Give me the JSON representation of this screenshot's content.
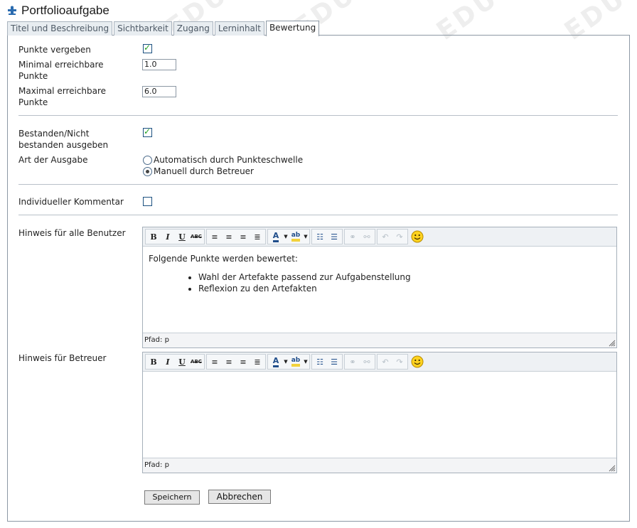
{
  "header": {
    "title": "Portfolioaufgabe",
    "icon": "puzzle-icon"
  },
  "watermark": "EDU",
  "tabs": [
    {
      "label": "Titel und Beschreibung",
      "active": false
    },
    {
      "label": "Sichtbarkeit",
      "active": false
    },
    {
      "label": "Zugang",
      "active": false
    },
    {
      "label": "Lerninhalt",
      "active": false
    },
    {
      "label": "Bewertung",
      "active": true
    }
  ],
  "form": {
    "punkte_vergeben": {
      "label": "Punkte vergeben",
      "checked": true
    },
    "min_punkte": {
      "label": "Minimal erreichbare Punkte",
      "value": "1.0"
    },
    "max_punkte": {
      "label": "Maximal erreichbare Punkte",
      "value": "6.0"
    },
    "bestanden": {
      "label": "Bestanden/Nicht bestanden ausgeben",
      "checked": true
    },
    "art_ausgabe": {
      "label": "Art der Ausgabe",
      "options": [
        {
          "label": "Automatisch durch Punkteschwelle",
          "selected": false
        },
        {
          "label": "Manuell durch Betreuer",
          "selected": true
        }
      ]
    },
    "kommentar": {
      "label": "Individueller Kommentar",
      "checked": false
    },
    "hinweis_alle": {
      "label": "Hinweis für alle Benutzer",
      "intro": "Folgende Punkte werden bewertet:",
      "items": [
        "Wahl der Artefakte passend zur Aufgabenstellung",
        "Reflexion zu den Artefakten"
      ],
      "path": "Pfad: p"
    },
    "hinweis_betreuer": {
      "label": "Hinweis für Betreuer",
      "path": "Pfad: p"
    }
  },
  "toolbar_labels": {
    "bold": "B",
    "italic": "I",
    "underline": "U",
    "strike": "ABC"
  },
  "buttons": {
    "save": "Speichern",
    "cancel": "Abbrechen"
  }
}
